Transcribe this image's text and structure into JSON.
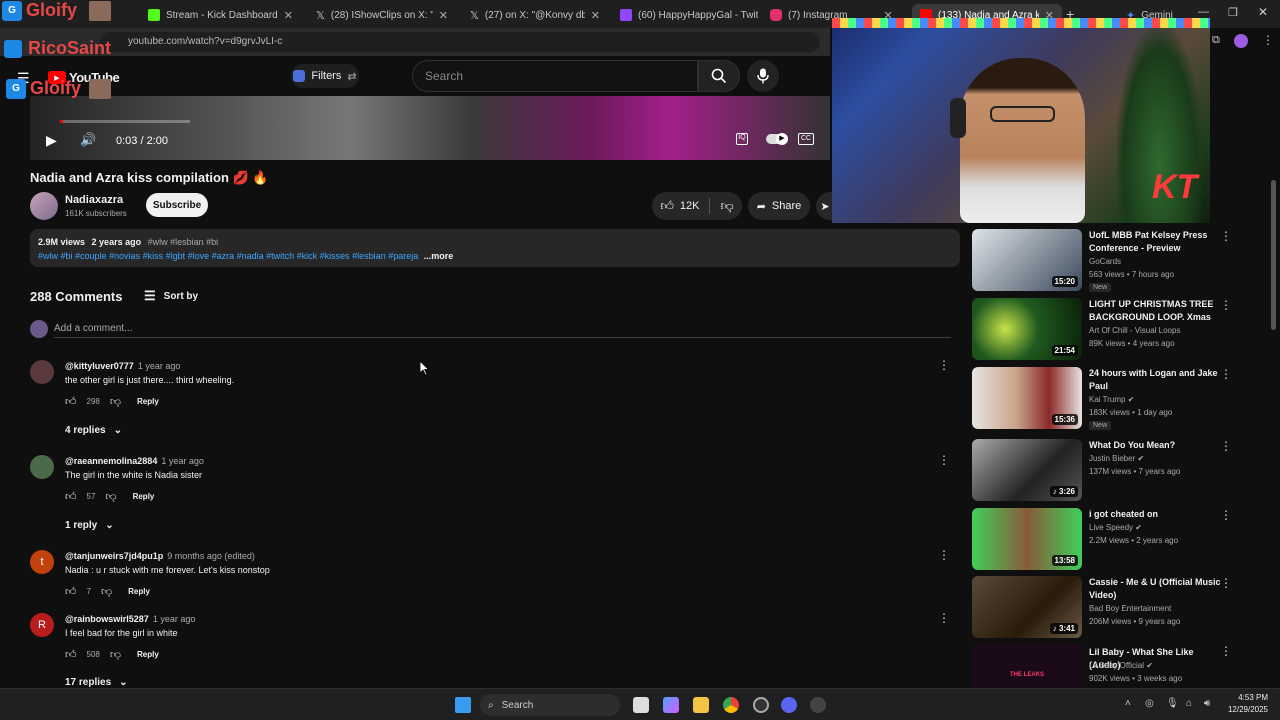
{
  "browser": {
    "tabs": [
      {
        "title": "Stream - Kick Dashboard",
        "color": "#53fc18"
      },
      {
        "title": "(28) IShowClips on X: \"This m",
        "color": "#ffffff"
      },
      {
        "title": "(27) on X: \"@Konvy dboy",
        "color": "#ffffff"
      },
      {
        "title": "(60) HappyHappyGal - Twitch",
        "color": "#9146ff"
      },
      {
        "title": "(7) Instagram",
        "color": "#e1306c"
      },
      {
        "title": "(133) Nadia and Azra kiss co",
        "color": "#ff0000"
      },
      {
        "title": "Gemini",
        "color": "#4e86f8"
      }
    ],
    "url": "youtube.com/watch?v=d9grvJvLI-c",
    "new_tab_symbol": "+"
  },
  "overlays": {
    "brand_top": "Gloify",
    "channel_name": "RicoSaint",
    "brand_left": "Gloify",
    "cam_letters": "KT"
  },
  "youtube": {
    "logo_text": "YouTube",
    "filters_label": "Filters",
    "search_placeholder": "Search"
  },
  "player": {
    "time": "0:03 / 2:00",
    "progress_fraction": 0.025
  },
  "video": {
    "title": "Nadia and Azra kiss compilation 💋 🔥",
    "channel": "Nadiaxazra",
    "subscribers": "161K subscribers",
    "subscribe_label": "Subscribe",
    "likes": "12K",
    "share_label": "Share",
    "views": "2.9M views",
    "age": "2 years ago",
    "header_tags": "#wlw #lesbian #bi",
    "tags": "#wlw #bi #couple #novias #kiss #lgbt #love #azra #nadia #twitch #kick #kisses #lesbian #pareja",
    "more_label": "...more"
  },
  "comments": {
    "count_label": "288 Comments",
    "sort_label": "Sort by",
    "add_placeholder": "Add a comment...",
    "items": [
      {
        "user": "@kittyluver0777",
        "time": "1 year ago",
        "text": "the other girl is just there.... third wheeling.",
        "likes": "298",
        "reply_label": "Reply",
        "replies": "4 replies",
        "avatar_letter": "",
        "avatar_color": "#5a3a3a"
      },
      {
        "user": "@raeannemolina2884",
        "time": "1 year ago",
        "text": "The girl in the white is Nadia sister",
        "likes": "57",
        "reply_label": "Reply",
        "replies": "1 reply",
        "avatar_letter": "",
        "avatar_color": "#4a6a4a"
      },
      {
        "user": "@tanjunweirs7jd4pu1p",
        "time": "9 months ago (edited)",
        "text": "Nadia : u r stuck with me forever. Let's kiss nonstop",
        "likes": "7",
        "reply_label": "Reply",
        "replies": "",
        "avatar_letter": "t",
        "avatar_color": "#c2410c"
      },
      {
        "user": "@rainbowswirl5287",
        "time": "1 year ago",
        "text": "I feel bad for the girl in white",
        "likes": "508",
        "reply_label": "Reply",
        "replies": "17 replies",
        "avatar_letter": "R",
        "avatar_color": "#b91c1c"
      }
    ]
  },
  "recommendations": [
    {
      "title": "UofL MBB Pat Kelsey Press Conference - Preview Californi...",
      "channel": "GoCards",
      "meta": "563 views • 7 hours ago",
      "badge": "New",
      "duration": "15:20",
      "verified": false,
      "thumb": "#3b4a5a"
    },
    {
      "title": "LIGHT UP CHRISTMAS TREE BACKGROUND LOOP. Xmas VJ...",
      "channel": "Art Of Chill - Visual Loops",
      "meta": "89K views • 4 years ago",
      "badge": "",
      "duration": "21:54",
      "verified": false,
      "thumb": "#1f5a1f"
    },
    {
      "title": "24 hours with Logan and Jake Paul",
      "channel": "Kai Trump",
      "meta": "183K views • 1 day ago",
      "badge": "New",
      "duration": "15:36",
      "verified": true,
      "thumb": "#7a5a4a"
    },
    {
      "title": "What Do You Mean?",
      "channel": "Justin Bieber",
      "meta": "137M views • 7 years ago",
      "badge": "",
      "duration": "3:26",
      "verified": true,
      "thumb": "#4a4a4a"
    },
    {
      "title": "i got cheated on",
      "channel": "Live Speedy",
      "meta": "2.2M views • 2 years ago",
      "badge": "",
      "duration": "13:58",
      "verified": true,
      "thumb": "#2f8a3a"
    },
    {
      "title": "Cassie - Me & U (Official Music Video)",
      "channel": "Bad Boy Entertainment",
      "meta": "206M views • 9 years ago",
      "badge": "",
      "duration": "3:41",
      "verified": false,
      "thumb": "#3a2a1a"
    },
    {
      "title": "Lil Baby - What She Like (Audio)",
      "channel": "Lil Baby Official",
      "meta": "902K views • 3 weeks ago",
      "badge": "",
      "duration": "",
      "verified": true,
      "thumb": "#1a0a1a",
      "thumb_text": "THE LEAKS"
    }
  ],
  "taskbar": {
    "search_label": "Search",
    "time": "4:53 PM",
    "date": "12/29/2025"
  }
}
